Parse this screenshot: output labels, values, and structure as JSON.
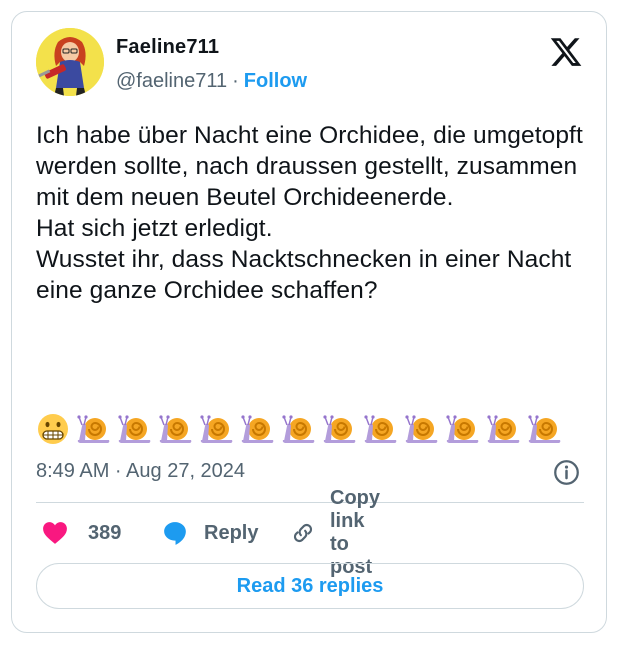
{
  "colors": {
    "accent": "#1d9bf0",
    "secondary_text": "#536471",
    "border": "#cfd9de",
    "like": "#f91880"
  },
  "author": {
    "display_name": "Faeline711",
    "handle": "@faeline711",
    "separator": "·",
    "follow_label": "Follow",
    "avatar_icon": "cartoon-woman-with-chainsaw-avatar"
  },
  "platform_logo": "x-logo-icon",
  "tweet": {
    "text": "Ich habe über Nacht eine Orchidee, die umgetopft werden sollte, nach draussen gestellt, zusammen mit dem neuen Beutel Orchideenerde.\nHat sich jetzt erledigt.\nWusstet ihr, dass Nacktschnecken in einer Nacht eine ganze Orchidee schaffen?",
    "emojis": [
      "grimacing-face-emoji",
      "snail-emoji",
      "snail-emoji",
      "snail-emoji",
      "snail-emoji",
      "snail-emoji",
      "snail-emoji",
      "snail-emoji",
      "snail-emoji",
      "snail-emoji",
      "snail-emoji",
      "snail-emoji",
      "snail-emoji"
    ],
    "timestamp": "8:49 AM · Aug 27, 2024"
  },
  "actions": {
    "like_count": "389",
    "reply_label": "Reply",
    "copy_label": "Copy link to post"
  },
  "read_replies_label": "Read 36 replies"
}
